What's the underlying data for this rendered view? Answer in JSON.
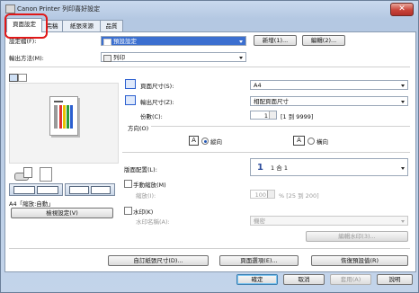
{
  "window": {
    "title": "Canon Printer 列印喜好設定",
    "close_label": "✕"
  },
  "tabs": [
    "頁面設定",
    "完稿",
    "紙張來源",
    "品質"
  ],
  "profile": {
    "label": "設定檔(F):",
    "value": "預設設定",
    "add": "新增(1)...",
    "edit": "編輯(2)..."
  },
  "output": {
    "label": "輸出方法(M):",
    "value": "列印"
  },
  "preview": {
    "caption": "A4「縮放:自動」",
    "view_settings": "檢視設定(V)"
  },
  "page_size": {
    "label": "頁面尺寸(S):",
    "value": "A4"
  },
  "output_size": {
    "label": "輸出尺寸(Z):",
    "value": "相配頁面尺寸"
  },
  "copies": {
    "label": "份數(C):",
    "value": "1",
    "range": "[1 到 9999]"
  },
  "orientation": {
    "label": "方向(O)",
    "portrait": "縱向",
    "landscape": "橫向",
    "selected": "portrait"
  },
  "page_layout": {
    "label": "版面配置(L):",
    "value": "1 合 1",
    "number": "1"
  },
  "manual_scaling": {
    "label": "手動縮放(M)",
    "scale_label": "縮放(I):",
    "value": "100",
    "range": "% [25 到 200]"
  },
  "watermark": {
    "label": "水印(K)",
    "name_label": "水印名稱(A):",
    "value": "機密",
    "edit": "編輯水印(3)..."
  },
  "bottom_buttons": {
    "custom_size": "自訂紙張尺寸(D)...",
    "page_options": "頁面選項(E)...",
    "restore": "恢復預設值(R)"
  },
  "dialog_buttons": {
    "ok": "確定",
    "cancel": "取消",
    "apply": "套用(A)",
    "help": "說明"
  },
  "colors": {
    "highlight": "#e01818",
    "accent": "#3b6fd0"
  }
}
